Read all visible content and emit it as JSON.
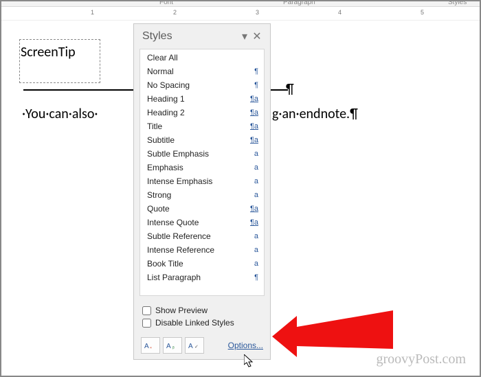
{
  "ribbon_labels": {
    "font": "Font",
    "paragraph": "Paragraph",
    "styles_group": "Styles"
  },
  "ruler": {
    "m1": "1",
    "m2": "2",
    "m3": "3",
    "m4": "4",
    "m5": "5"
  },
  "document": {
    "screentip": "ScreenTip",
    "body_line_pre": "·You·can·also·",
    "body_line_post": "g·an·endnote.¶",
    "pmark_after_hr": "¶"
  },
  "styles_pane": {
    "title": "Styles",
    "items": [
      {
        "label": "Clear All",
        "sym": ""
      },
      {
        "label": "Normal",
        "sym": "¶"
      },
      {
        "label": "No Spacing",
        "sym": "¶"
      },
      {
        "label": "Heading 1",
        "sym": "¶a",
        "under": true
      },
      {
        "label": "Heading 2",
        "sym": "¶a",
        "under": true
      },
      {
        "label": "Title",
        "sym": "¶a",
        "under": true
      },
      {
        "label": "Subtitle",
        "sym": "¶a",
        "under": true
      },
      {
        "label": "Subtle Emphasis",
        "sym": "a"
      },
      {
        "label": "Emphasis",
        "sym": "a"
      },
      {
        "label": "Intense Emphasis",
        "sym": "a"
      },
      {
        "label": "Strong",
        "sym": "a"
      },
      {
        "label": "Quote",
        "sym": "¶a",
        "under": true
      },
      {
        "label": "Intense Quote",
        "sym": "¶a",
        "under": true
      },
      {
        "label": "Subtle Reference",
        "sym": "a"
      },
      {
        "label": "Intense Reference",
        "sym": "a"
      },
      {
        "label": "Book Title",
        "sym": "a"
      },
      {
        "label": "List Paragraph",
        "sym": "¶"
      }
    ],
    "show_preview": "Show Preview",
    "disable_linked": "Disable Linked Styles",
    "options": "Options..."
  },
  "watermark": "groovyPost.com"
}
